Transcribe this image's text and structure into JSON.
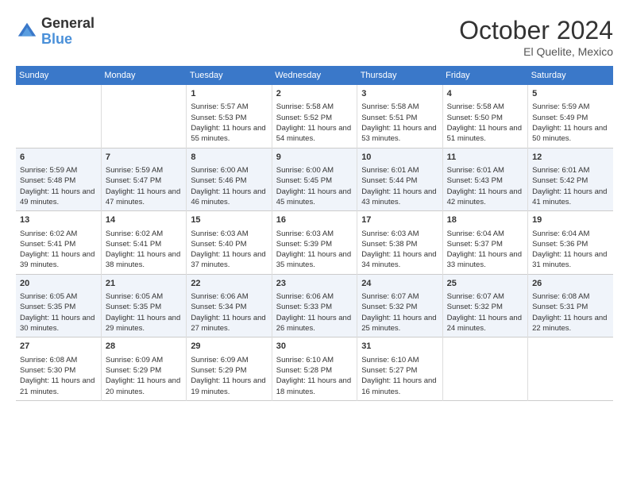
{
  "header": {
    "logo_line1": "General",
    "logo_line2": "Blue",
    "month_year": "October 2024",
    "location": "El Quelite, Mexico"
  },
  "days_of_week": [
    "Sunday",
    "Monday",
    "Tuesday",
    "Wednesday",
    "Thursday",
    "Friday",
    "Saturday"
  ],
  "weeks": [
    [
      {
        "day": "",
        "info": ""
      },
      {
        "day": "",
        "info": ""
      },
      {
        "day": "1",
        "info": "Sunrise: 5:57 AM\nSunset: 5:53 PM\nDaylight: 11 hours and 55 minutes."
      },
      {
        "day": "2",
        "info": "Sunrise: 5:58 AM\nSunset: 5:52 PM\nDaylight: 11 hours and 54 minutes."
      },
      {
        "day": "3",
        "info": "Sunrise: 5:58 AM\nSunset: 5:51 PM\nDaylight: 11 hours and 53 minutes."
      },
      {
        "day": "4",
        "info": "Sunrise: 5:58 AM\nSunset: 5:50 PM\nDaylight: 11 hours and 51 minutes."
      },
      {
        "day": "5",
        "info": "Sunrise: 5:59 AM\nSunset: 5:49 PM\nDaylight: 11 hours and 50 minutes."
      }
    ],
    [
      {
        "day": "6",
        "info": "Sunrise: 5:59 AM\nSunset: 5:48 PM\nDaylight: 11 hours and 49 minutes."
      },
      {
        "day": "7",
        "info": "Sunrise: 5:59 AM\nSunset: 5:47 PM\nDaylight: 11 hours and 47 minutes."
      },
      {
        "day": "8",
        "info": "Sunrise: 6:00 AM\nSunset: 5:46 PM\nDaylight: 11 hours and 46 minutes."
      },
      {
        "day": "9",
        "info": "Sunrise: 6:00 AM\nSunset: 5:45 PM\nDaylight: 11 hours and 45 minutes."
      },
      {
        "day": "10",
        "info": "Sunrise: 6:01 AM\nSunset: 5:44 PM\nDaylight: 11 hours and 43 minutes."
      },
      {
        "day": "11",
        "info": "Sunrise: 6:01 AM\nSunset: 5:43 PM\nDaylight: 11 hours and 42 minutes."
      },
      {
        "day": "12",
        "info": "Sunrise: 6:01 AM\nSunset: 5:42 PM\nDaylight: 11 hours and 41 minutes."
      }
    ],
    [
      {
        "day": "13",
        "info": "Sunrise: 6:02 AM\nSunset: 5:41 PM\nDaylight: 11 hours and 39 minutes."
      },
      {
        "day": "14",
        "info": "Sunrise: 6:02 AM\nSunset: 5:41 PM\nDaylight: 11 hours and 38 minutes."
      },
      {
        "day": "15",
        "info": "Sunrise: 6:03 AM\nSunset: 5:40 PM\nDaylight: 11 hours and 37 minutes."
      },
      {
        "day": "16",
        "info": "Sunrise: 6:03 AM\nSunset: 5:39 PM\nDaylight: 11 hours and 35 minutes."
      },
      {
        "day": "17",
        "info": "Sunrise: 6:03 AM\nSunset: 5:38 PM\nDaylight: 11 hours and 34 minutes."
      },
      {
        "day": "18",
        "info": "Sunrise: 6:04 AM\nSunset: 5:37 PM\nDaylight: 11 hours and 33 minutes."
      },
      {
        "day": "19",
        "info": "Sunrise: 6:04 AM\nSunset: 5:36 PM\nDaylight: 11 hours and 31 minutes."
      }
    ],
    [
      {
        "day": "20",
        "info": "Sunrise: 6:05 AM\nSunset: 5:35 PM\nDaylight: 11 hours and 30 minutes."
      },
      {
        "day": "21",
        "info": "Sunrise: 6:05 AM\nSunset: 5:35 PM\nDaylight: 11 hours and 29 minutes."
      },
      {
        "day": "22",
        "info": "Sunrise: 6:06 AM\nSunset: 5:34 PM\nDaylight: 11 hours and 27 minutes."
      },
      {
        "day": "23",
        "info": "Sunrise: 6:06 AM\nSunset: 5:33 PM\nDaylight: 11 hours and 26 minutes."
      },
      {
        "day": "24",
        "info": "Sunrise: 6:07 AM\nSunset: 5:32 PM\nDaylight: 11 hours and 25 minutes."
      },
      {
        "day": "25",
        "info": "Sunrise: 6:07 AM\nSunset: 5:32 PM\nDaylight: 11 hours and 24 minutes."
      },
      {
        "day": "26",
        "info": "Sunrise: 6:08 AM\nSunset: 5:31 PM\nDaylight: 11 hours and 22 minutes."
      }
    ],
    [
      {
        "day": "27",
        "info": "Sunrise: 6:08 AM\nSunset: 5:30 PM\nDaylight: 11 hours and 21 minutes."
      },
      {
        "day": "28",
        "info": "Sunrise: 6:09 AM\nSunset: 5:29 PM\nDaylight: 11 hours and 20 minutes."
      },
      {
        "day": "29",
        "info": "Sunrise: 6:09 AM\nSunset: 5:29 PM\nDaylight: 11 hours and 19 minutes."
      },
      {
        "day": "30",
        "info": "Sunrise: 6:10 AM\nSunset: 5:28 PM\nDaylight: 11 hours and 18 minutes."
      },
      {
        "day": "31",
        "info": "Sunrise: 6:10 AM\nSunset: 5:27 PM\nDaylight: 11 hours and 16 minutes."
      },
      {
        "day": "",
        "info": ""
      },
      {
        "day": "",
        "info": ""
      }
    ]
  ]
}
